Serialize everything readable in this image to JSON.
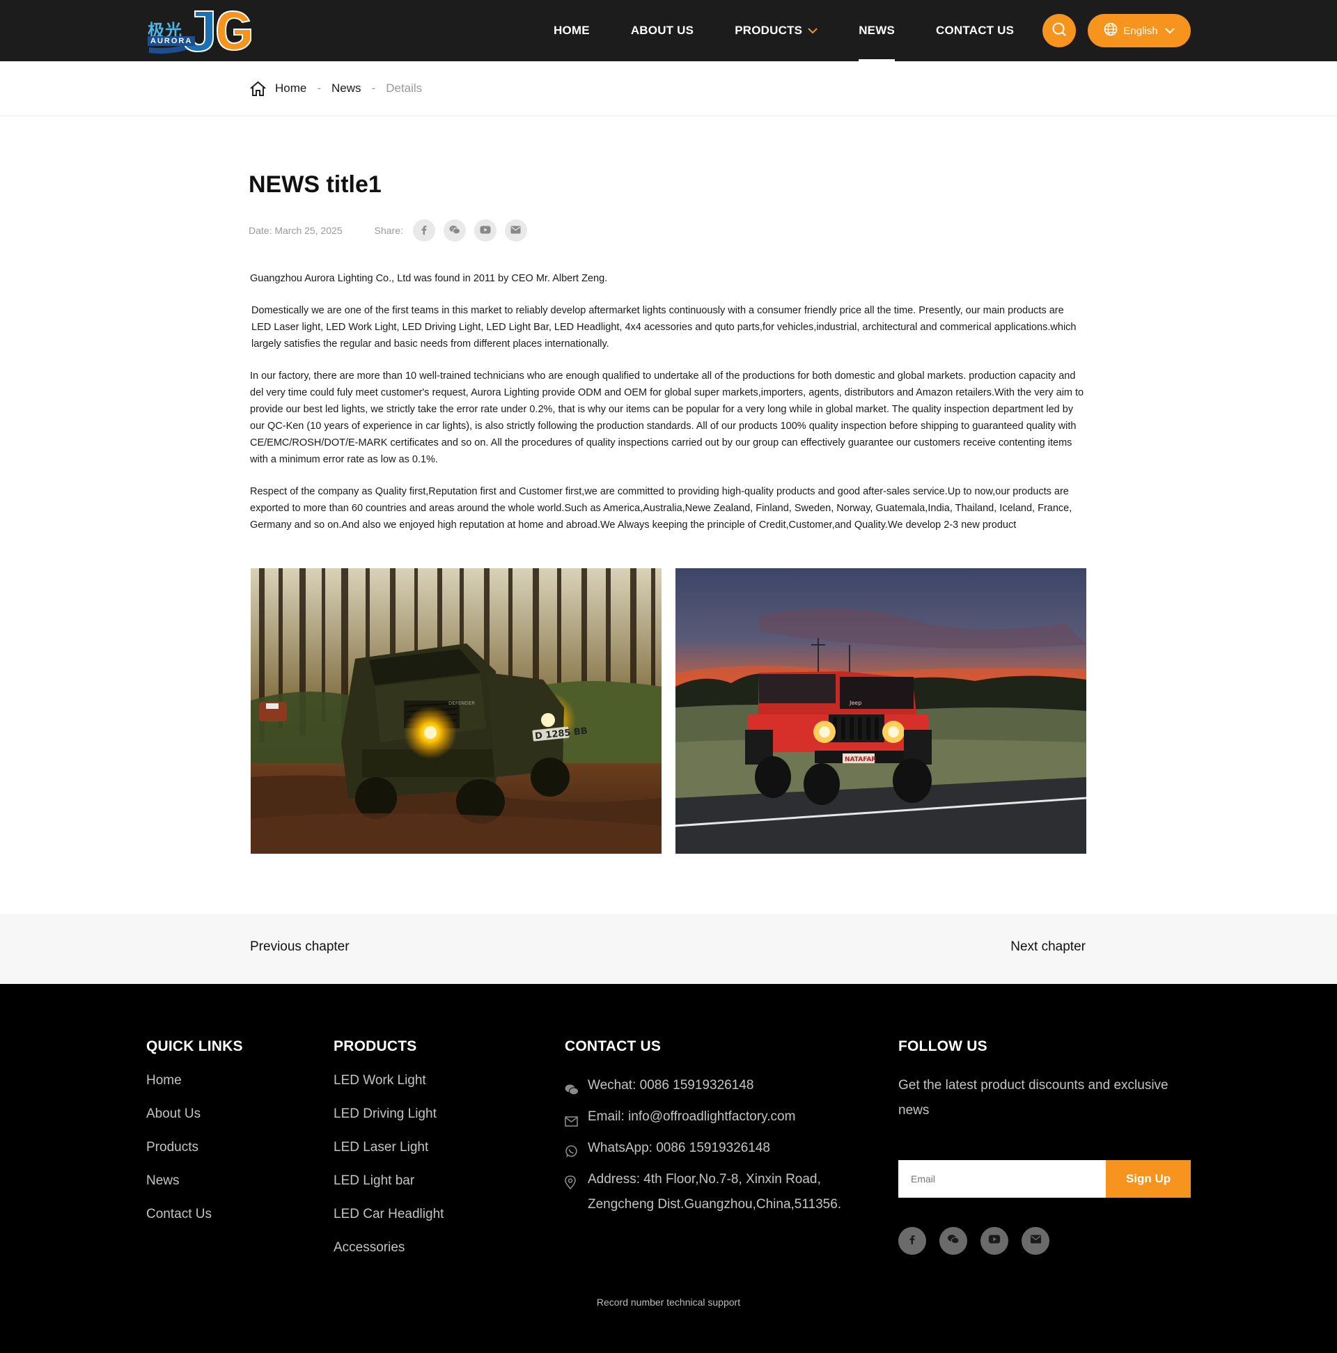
{
  "header": {
    "logo_cn": "极光",
    "logo_en": "AURORA",
    "nav": [
      {
        "label": "HOME"
      },
      {
        "label": "ABOUT US"
      },
      {
        "label": "PRODUCTS"
      },
      {
        "label": "NEWS"
      },
      {
        "label": "CONTACT US"
      }
    ],
    "active_nav": "NEWS",
    "language": "English",
    "accent_color": "#f7941d"
  },
  "breadcrumb": {
    "home": "Home",
    "news": "News",
    "details": "Details",
    "separator": "-"
  },
  "article": {
    "title": "NEWS title1",
    "date": "Date: March 25, 2025",
    "share_label": "Share:",
    "share_icons": [
      "facebook-icon",
      "wechat-icon",
      "youtube-icon",
      "email-icon"
    ],
    "paragraphs": [
      "Guangzhou Aurora Lighting Co., Ltd was found in 2011 by CEO Mr. Albert Zeng.",
      "Domestically we are one of the first teams in this market to reliably develop aftermarket lights continuously with a consumer friendly price all the time. Presently, our main products are LED Laser light, LED Work Light, LED Driving Light, LED Light Bar, LED Headlight, 4x4 acessories and quto parts,for vehicles,industrial, architectural and commerical applications.which largely satisfies the regular and basic needs from different places internationally.",
      "In our factory, there are more than 10 well-trained technicians who are enough qualified to undertake all of the productions for both domestic and global markets. production capacity and del very time could fuly meet customer's request, Aurora Lighting provide ODM and OEM for global super markets,importers, agents, distributors and Amazon retailers.With the very aim to provide our best led lights, we strictly take the error rate under 0.2%, that is why our items can be popular for a very long while in global market. The quality inspection department led by our QC-Ken (10 years of experience in car lights), is also strictly following the production standards. All of our products 100% quality inspection before shipping to guaranteed quality with CE/EMC/ROSH/DOT/E-MARK certificates and so on. All the procedures of quality inspections carried out by our group can effectively guarantee our customers receive contenting items with a minimum error rate as low as 0.1%.",
      "Respect of the company as Quality first,Reputation first and Customer first,we are committed to providing high-quality products and good after-sales service.Up to now,our products are exported to more than 60 countries and areas around the whole world.Such as America,Australia,Newe Zealand, Finland, Sweden, Norway, Guatemala,India, Thailand, Iceland, France, Germany and so on.And also we enjoyed high reputation at home and abroad.We Always keeping the principle of Credit,Customer,and Quality.We develop 2-3 new product"
    ],
    "plate_left": "D 1285 BB",
    "plate_left_badge": "DEFENDER",
    "plate_right": "NATAFAR",
    "plate_right_badge": "Jeep"
  },
  "chapters": {
    "previous": "Previous chapter",
    "next": "Next chapter"
  },
  "footer": {
    "quick_links": {
      "heading": "QUICK LINKS",
      "items": [
        "Home",
        "About Us",
        "Products",
        "News",
        "Contact Us"
      ]
    },
    "products": {
      "heading": "PRODUCTS",
      "items": [
        "LED Work Light",
        "LED Driving Light",
        "LED Laser Light",
        "LED Light bar",
        "LED Car Headlight",
        "Accessories"
      ]
    },
    "contact": {
      "heading": "CONTACT US",
      "wechat": "Wechat: 0086 15919326148",
      "email": "Email: info@offroadlightfactory.com",
      "whatsapp": "WhatsApp: 0086 15919326148",
      "address_line1": "Address: 4th Floor,No.7-8, Xinxin Road,",
      "address_line2": "Zengcheng Dist.Guangzhou,China,511356."
    },
    "follow": {
      "heading": "FOLLOW US",
      "text": "Get the latest product discounts and exclusive news",
      "email_placeholder": "Email",
      "signup": "Sign Up",
      "social_icons": [
        "facebook-icon",
        "wechat-icon",
        "youtube-icon",
        "email-icon"
      ]
    },
    "record": "Record number technical support"
  }
}
